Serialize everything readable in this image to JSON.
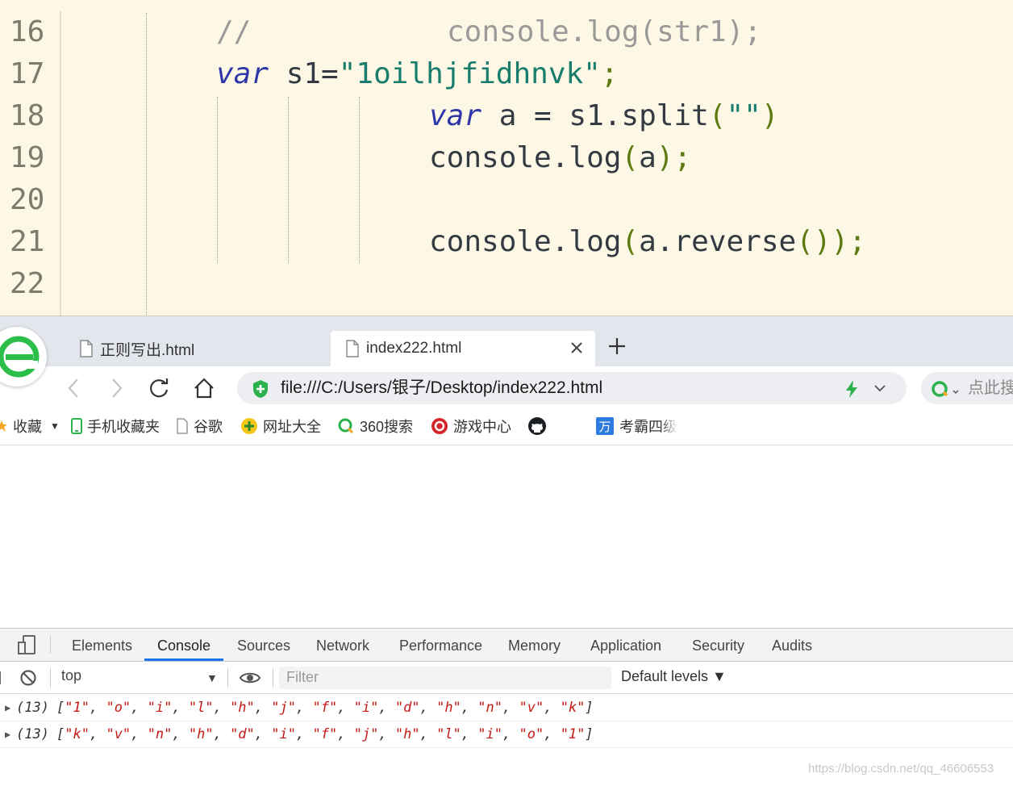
{
  "editor": {
    "lines": [
      {
        "num": "16",
        "comment": "//",
        "comment_code": "console.log(str1);"
      },
      {
        "num": "17",
        "kw": "var",
        "name": " s1=",
        "str": "\"1oilhjfidhnvk\"",
        "end": ";"
      },
      {
        "num": "18",
        "kw": "var",
        "rest": " a = s1.split",
        "open": "(",
        "str": "\"\"",
        "close": ")"
      },
      {
        "num": "19",
        "obj": "console.log",
        "open": "(",
        "arg": "a",
        "close": ")",
        "end": ";"
      },
      {
        "num": "20"
      },
      {
        "num": "21",
        "obj": "console.log",
        "open": "(",
        "arg": "a.reverse",
        "inner": "()",
        "close": ")",
        "end": ";"
      },
      {
        "num": "22"
      }
    ]
  },
  "browser": {
    "tabs": [
      {
        "label": "正则写出.html"
      },
      {
        "label": "index222.html"
      }
    ],
    "address": "file:///C:/Users/银子/Desktop/index222.html",
    "search_placeholder": "点此搜",
    "bookmarks": {
      "favorites": "收藏",
      "mobile": "手机收藏夹",
      "google": "谷歌",
      "sites": "网址大全",
      "search360": "360搜索",
      "games": "游戏中心",
      "kaoba": "考霸四级"
    }
  },
  "devtools": {
    "tabs": [
      "Elements",
      "Console",
      "Sources",
      "Network",
      "Performance",
      "Memory",
      "Application",
      "Security",
      "Audits"
    ],
    "active_tab": "Console",
    "context": "top",
    "filter_placeholder": "Filter",
    "levels": "Default levels ▼",
    "console_rows": [
      {
        "count": "(13)",
        "items": [
          "1",
          "o",
          "i",
          "l",
          "h",
          "j",
          "f",
          "i",
          "d",
          "h",
          "n",
          "v",
          "k"
        ]
      },
      {
        "count": "(13)",
        "items": [
          "k",
          "v",
          "n",
          "h",
          "d",
          "i",
          "f",
          "j",
          "h",
          "l",
          "i",
          "o",
          "1"
        ]
      }
    ]
  },
  "watermark": "https://blog.csdn.net/qq_46606553",
  "colors": {
    "editor_bg": "#fdf8e6",
    "keyword": "#2e36a8",
    "string": "#1a7c6c",
    "console_string": "#c41a16",
    "active_tab": "#1a73e8"
  }
}
